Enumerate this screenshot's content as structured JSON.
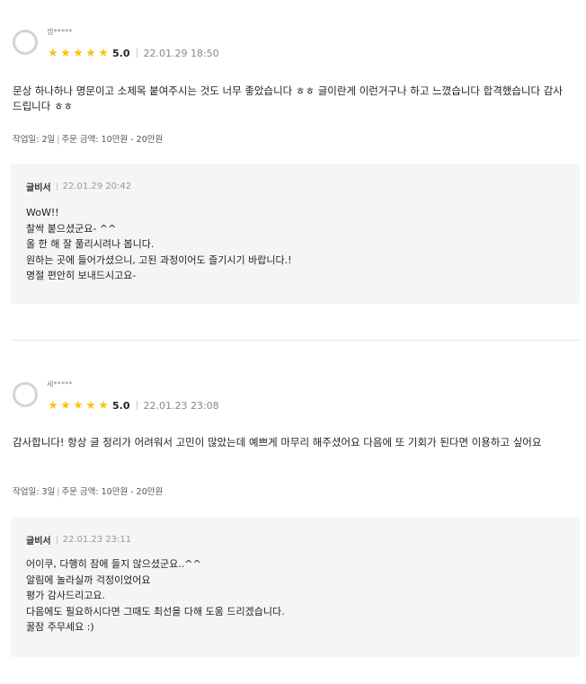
{
  "reviews": [
    {
      "user": "잼*****",
      "stars": 5,
      "score": "5.0",
      "date": "22.01.29 18:50",
      "text": "문상 하나하나 명문이고 소제목 붙여주시는 것도 너무 좋았습니다 ㅎㅎ 글이란게 이런거구나 하고 느꼈습니다 합격했습니다 감사드립니다 ㅎㅎ",
      "work_days": "작업일: 2일",
      "order_amount": "주문 금액: 10만원 - 20만원",
      "reply": {
        "author": "글비서",
        "date": "22.01.29 20:42",
        "lines": [
          "WoW!!",
          "찰싹 붙으셨군요- ^^",
          "올 한 해 잘 풀리시려나 봅니다.",
          "원하는 곳에 들어가셨으니, 고된 과정이어도 즐기시기 바랍니다.!",
          "명절 편안히 보내드시고요-"
        ]
      }
    },
    {
      "user": "세*****",
      "stars": 5,
      "score": "5.0",
      "date": "22.01.23 23:08",
      "text": "감사합니다! 항상 글 정리가 어려워서 고민이 많았는데 예쁘게 마무리 해주셨어요 다음에 또 기회가 된다면 이용하고 싶어요",
      "work_days": "작업일: 3일",
      "order_amount": "주문 금액: 10만원 - 20만원",
      "reply": {
        "author": "글비서",
        "date": "22.01.23 23:11",
        "lines": [
          "어이쿠, 다행히 잠에 들지 않으셨군요..^^",
          "알림에 놀라실까 걱정이었어요",
          "평가 감사드리고요.",
          "다음에도 필요하시다면 그때도 최선을 다해 도움 드리겠습니다.",
          "꿀잠 주무세요 :)"
        ]
      }
    }
  ]
}
